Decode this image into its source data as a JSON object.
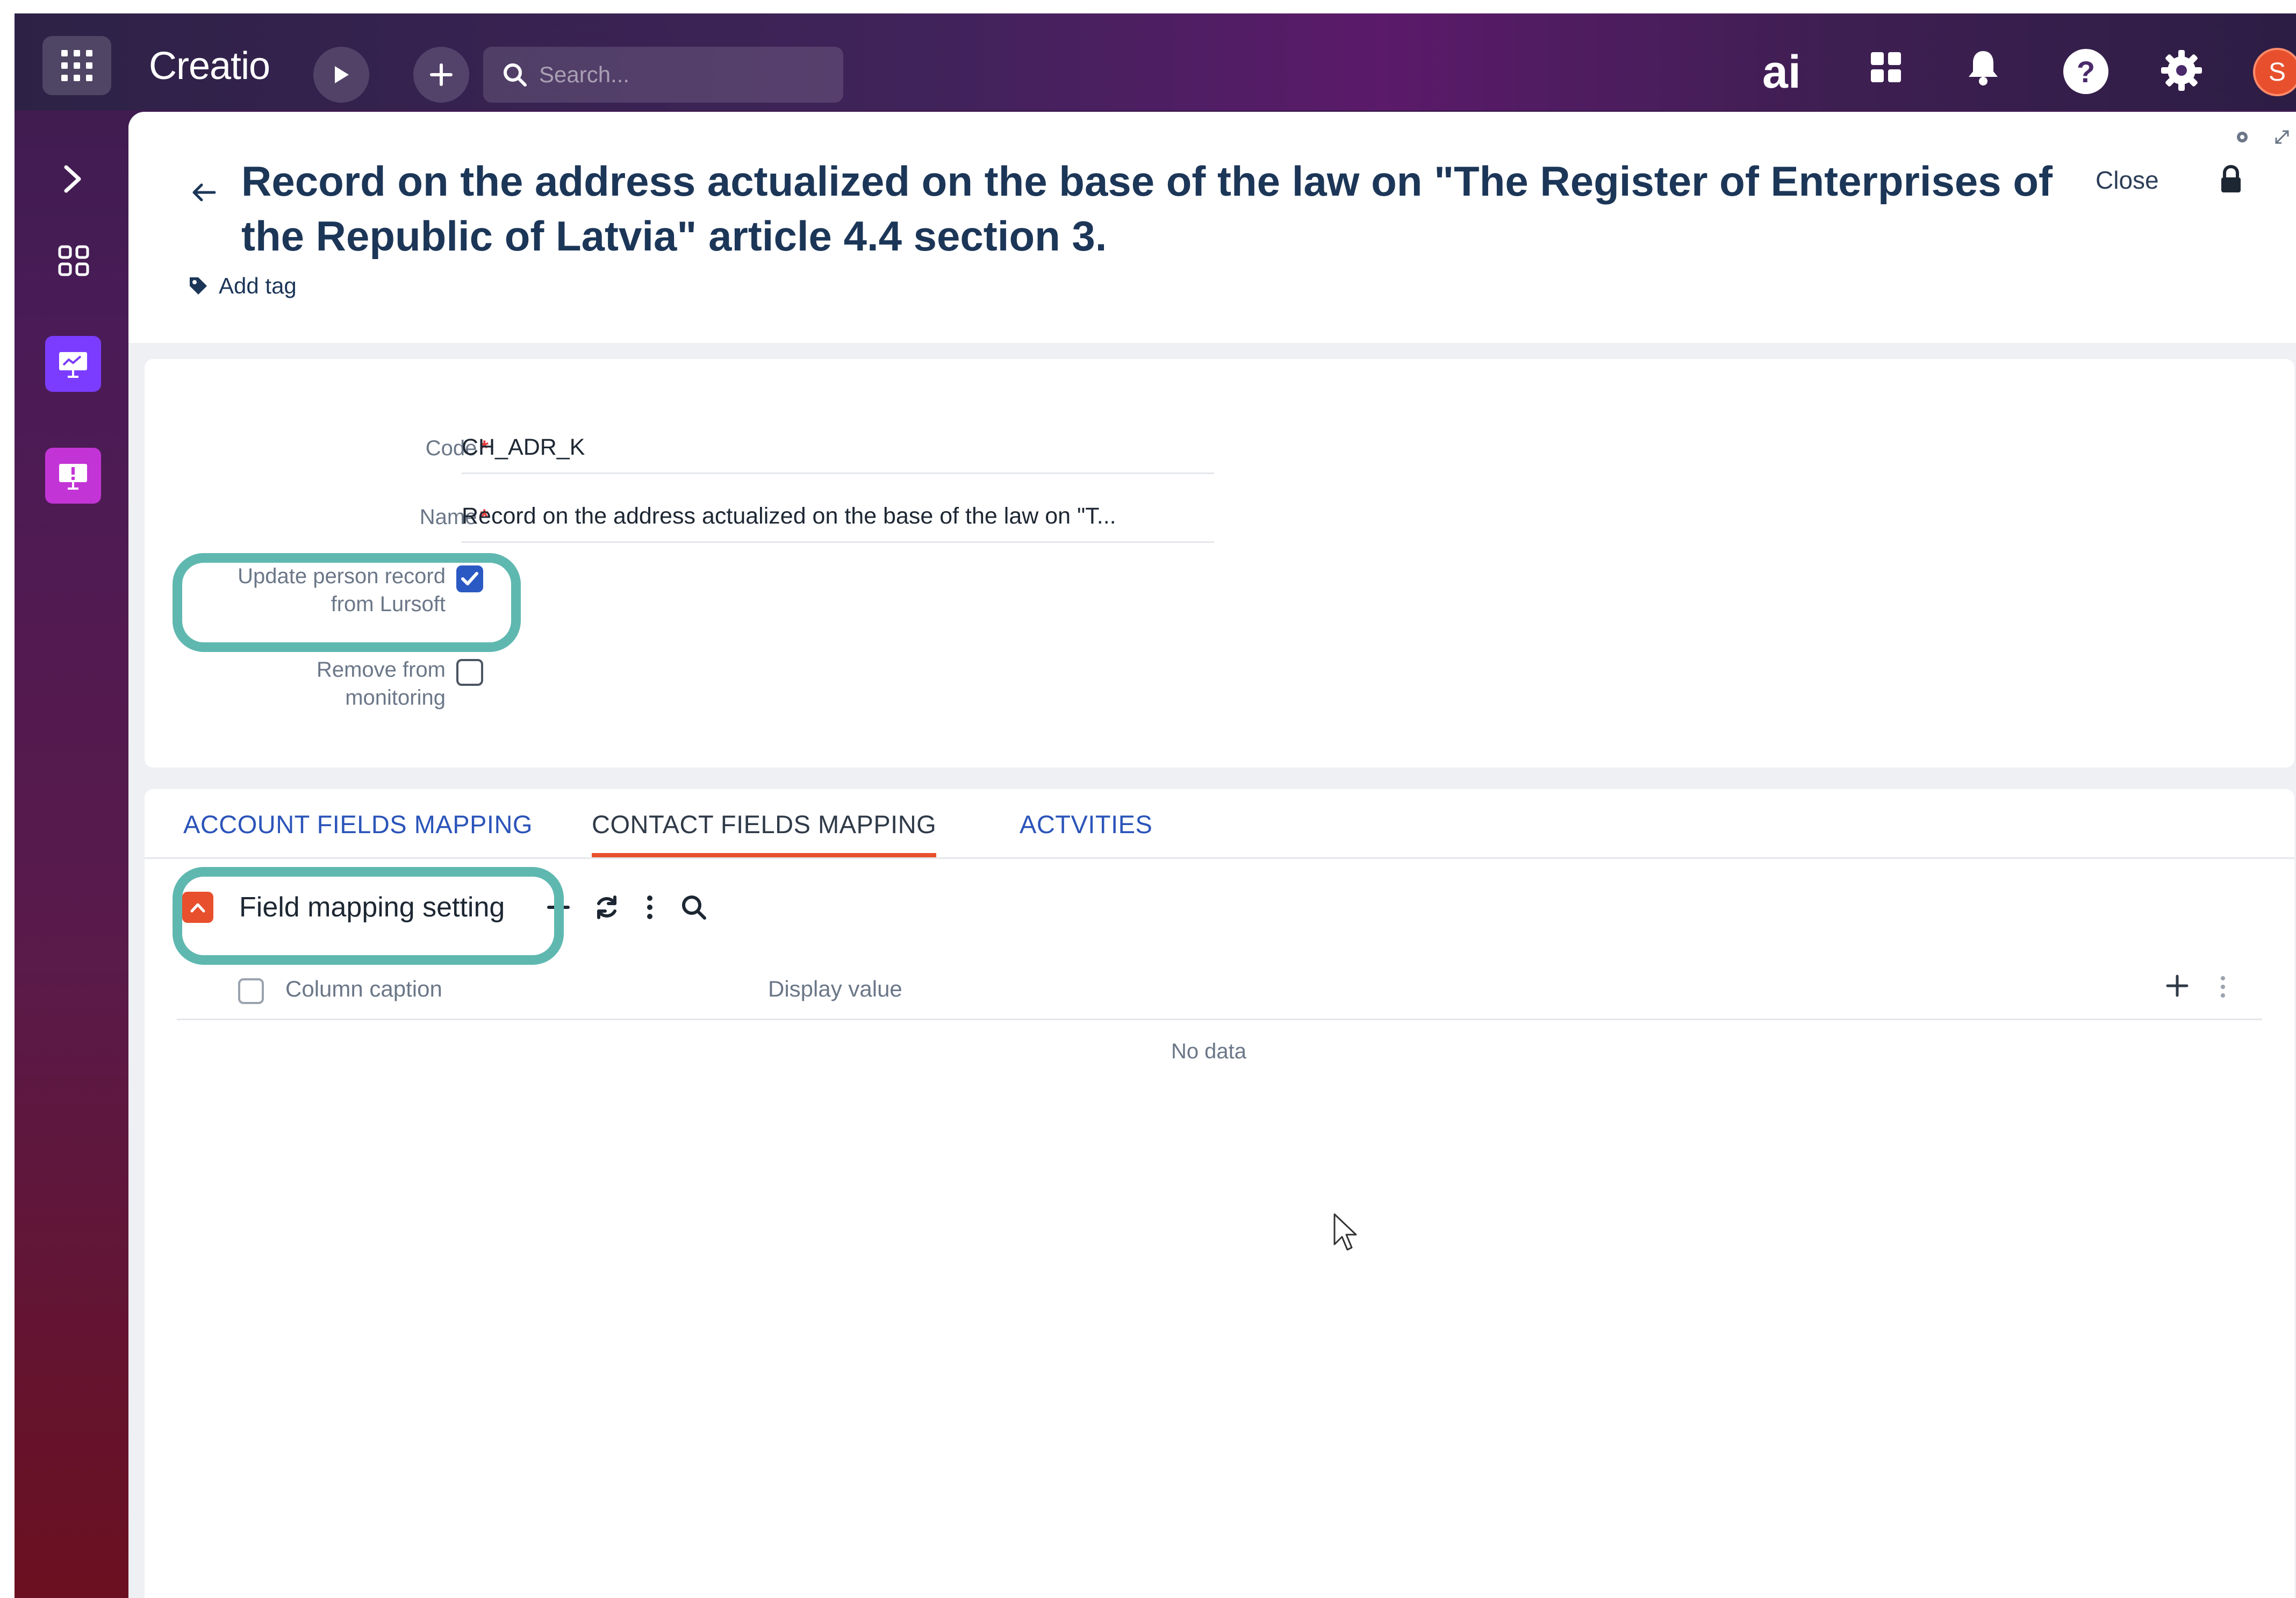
{
  "topbar": {
    "logo": "Creatio",
    "search_placeholder": "Search...",
    "ai_label": "ai",
    "avatar_initial": "S",
    "icons": [
      "apps-grid-icon",
      "play-icon",
      "plus-icon",
      "search-icon",
      "ai-icon",
      "app-tiles-icon",
      "bell-icon",
      "help-icon",
      "gear-icon"
    ]
  },
  "sidebar": {
    "icons": [
      "chevron-right-icon",
      "dashboard-icon",
      "presentation-icon",
      "alert-board-icon"
    ]
  },
  "record": {
    "title": "Record on the address actualized on the base of the law on \"The Register of Enterprises of the Republic of Latvia\" article 4.4 section 3.",
    "close_label": "Close",
    "add_tag_label": "Add tag"
  },
  "form": {
    "code_label": "Code",
    "code_value": "CH_ADR_K",
    "name_label": "Name",
    "name_value": "Record on the address actualized on the base of the law on \"T...",
    "update_label_line1": "Update person record",
    "update_label_line2": "from Lursoft",
    "update_checked": true,
    "remove_label_line1": "Remove from",
    "remove_label_line2": "monitoring",
    "remove_checked": false,
    "required_mark": "*"
  },
  "tabs": [
    {
      "label": "ACCOUNT FIELDS MAPPING",
      "active": false
    },
    {
      "label": "CONTACT FIELDS MAPPING",
      "active": true
    },
    {
      "label": "ACTVITIES",
      "active": false
    }
  ],
  "detail": {
    "title": "Field mapping setting",
    "columns": [
      "Column caption",
      "Display value"
    ],
    "empty_text": "No data"
  },
  "colors": {
    "accent_orange": "#e8502d",
    "highlight_teal": "#5fb8b0",
    "title_navy": "#1c3658",
    "tab_blue": "#2b54b9",
    "checkbox_blue": "#2b59c3"
  }
}
